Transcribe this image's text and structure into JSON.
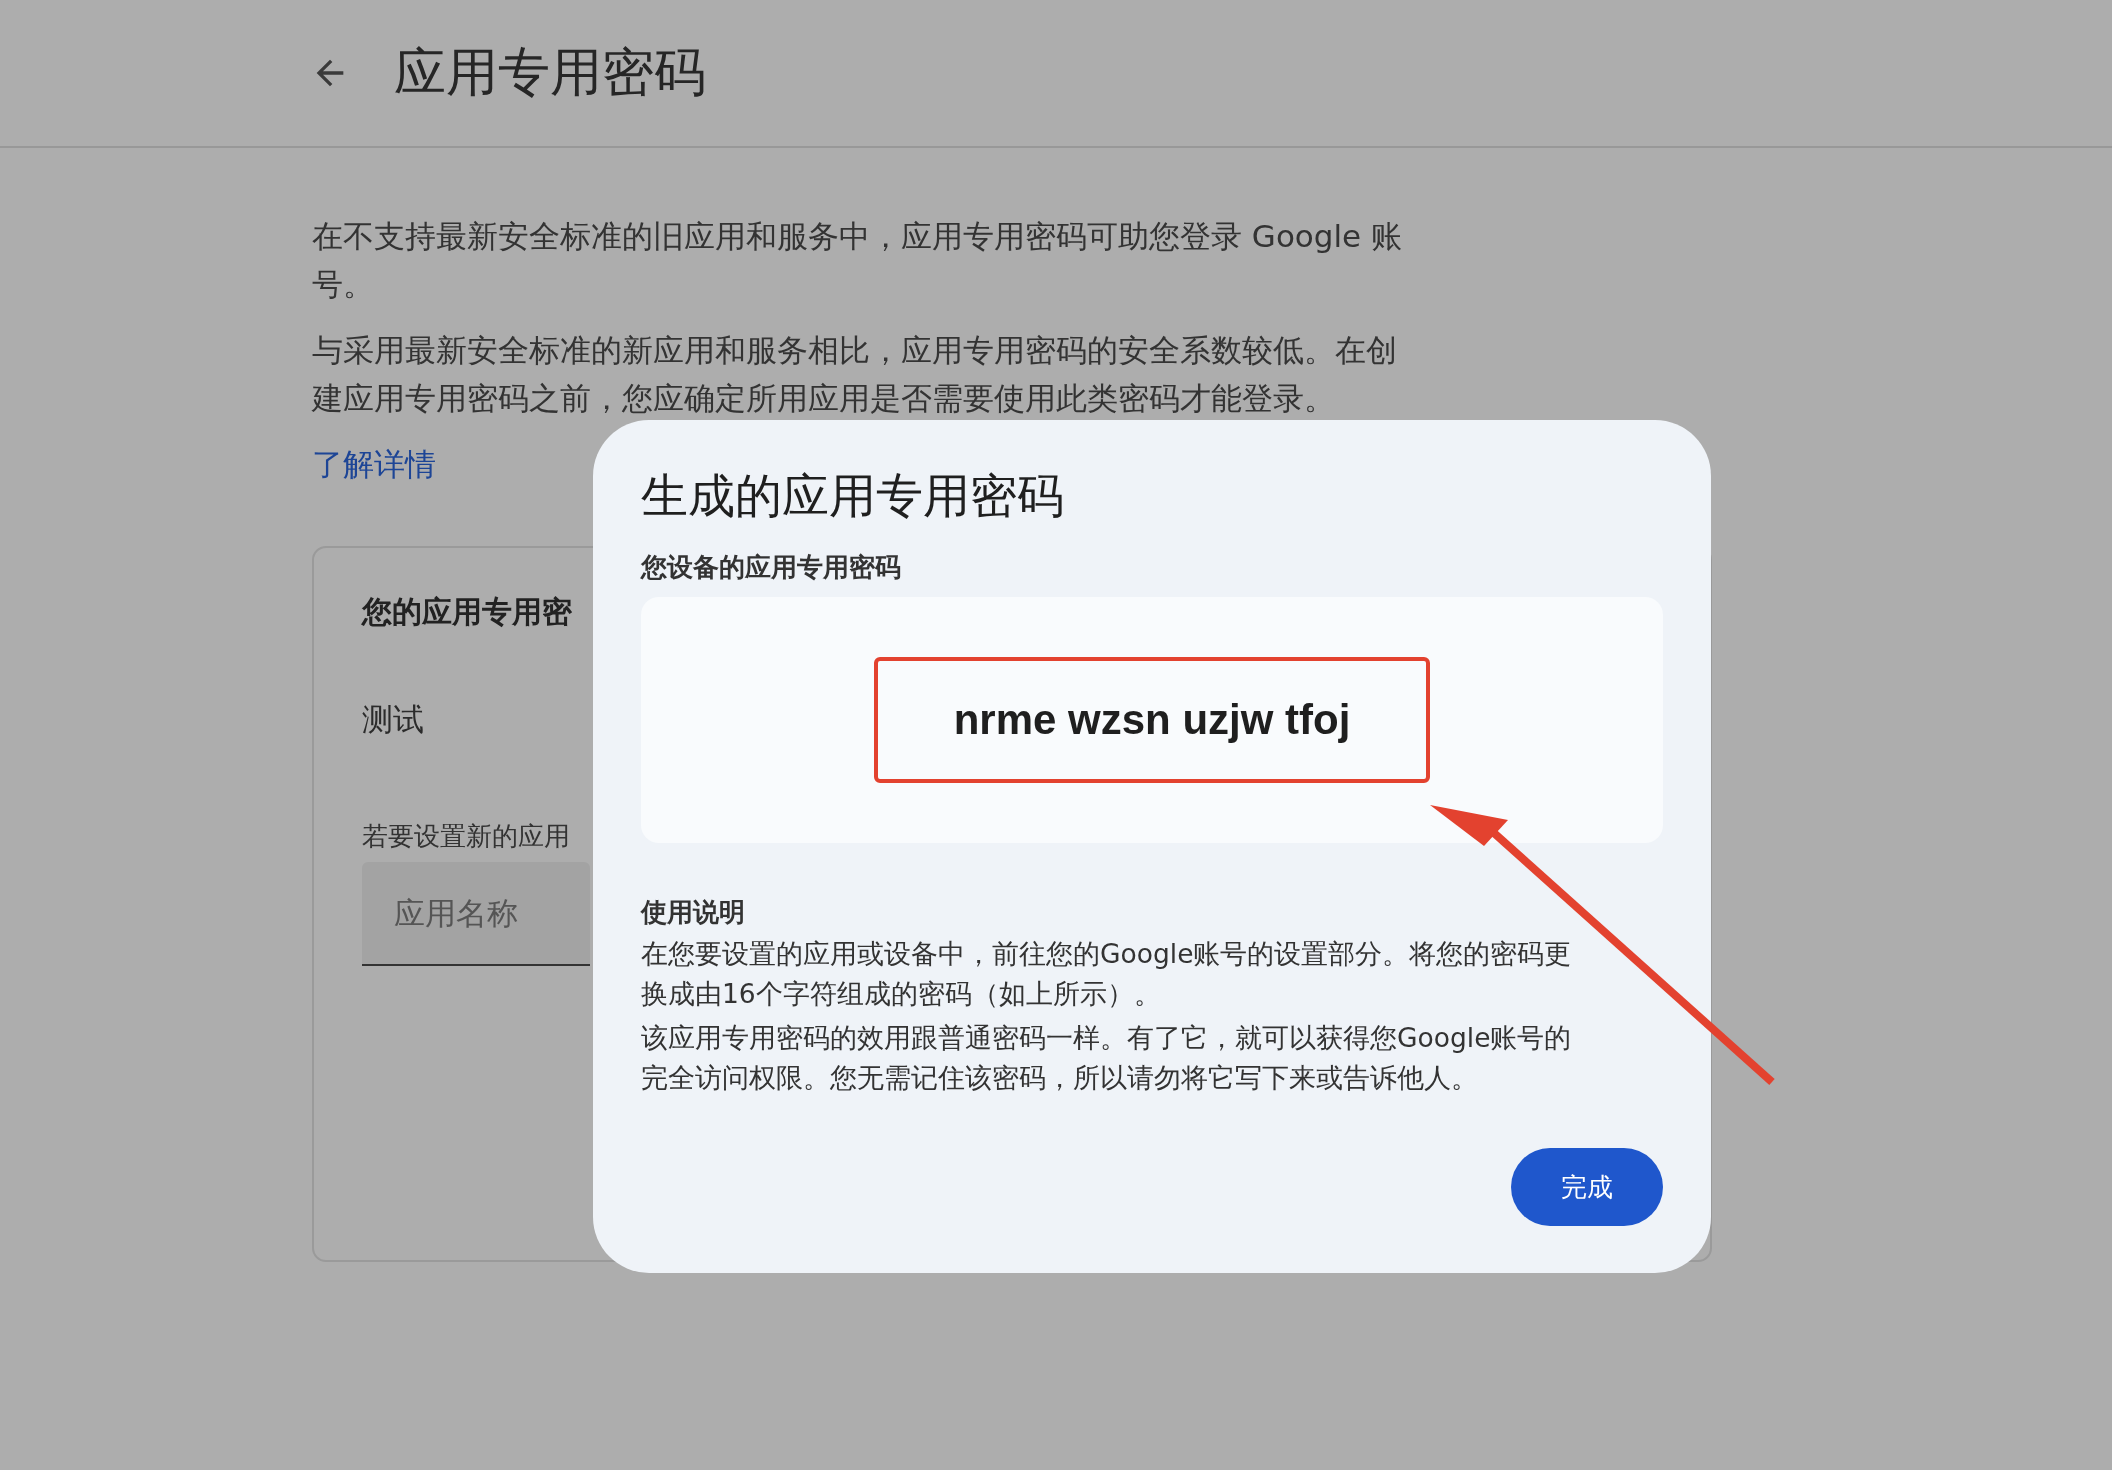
{
  "header": {
    "title": "应用专用密码"
  },
  "intro": {
    "paragraphs": [
      "在不支持最新安全标准的旧应用和服务中，应用专用密码可助您登录 Google 账号。",
      "与采用最新安全标准的新应用和服务相比，应用专用密码的安全系数较低。在创建应用专用密码之前，您应确定所用应用是否需要使用此类密码才能登录。"
    ],
    "link": "了解详情"
  },
  "card": {
    "title": "您的应用专用密",
    "apps": [
      "测试"
    ],
    "new_prompt": "若要设置新的应用",
    "name_field": {
      "placeholder": "应用名称"
    }
  },
  "dialog": {
    "title": "生成的应用专用密码",
    "password_label": "您设备的应用专用密码",
    "password": "nrme wzsn uzjw tfoj",
    "instructions_title": "使用说明",
    "instructions": [
      "在您要设置的应用或设备中，前往您的Google账号的设置部分。将您的密码更换成由16个字符组成的密码（如上所示）。",
      "该应用专用密码的效用跟普通密码一样。有了它，就可以获得您Google账号的完全访问权限。您无需记住该密码，所以请勿将它写下来或告诉他人。"
    ],
    "done_button": "完成"
  }
}
